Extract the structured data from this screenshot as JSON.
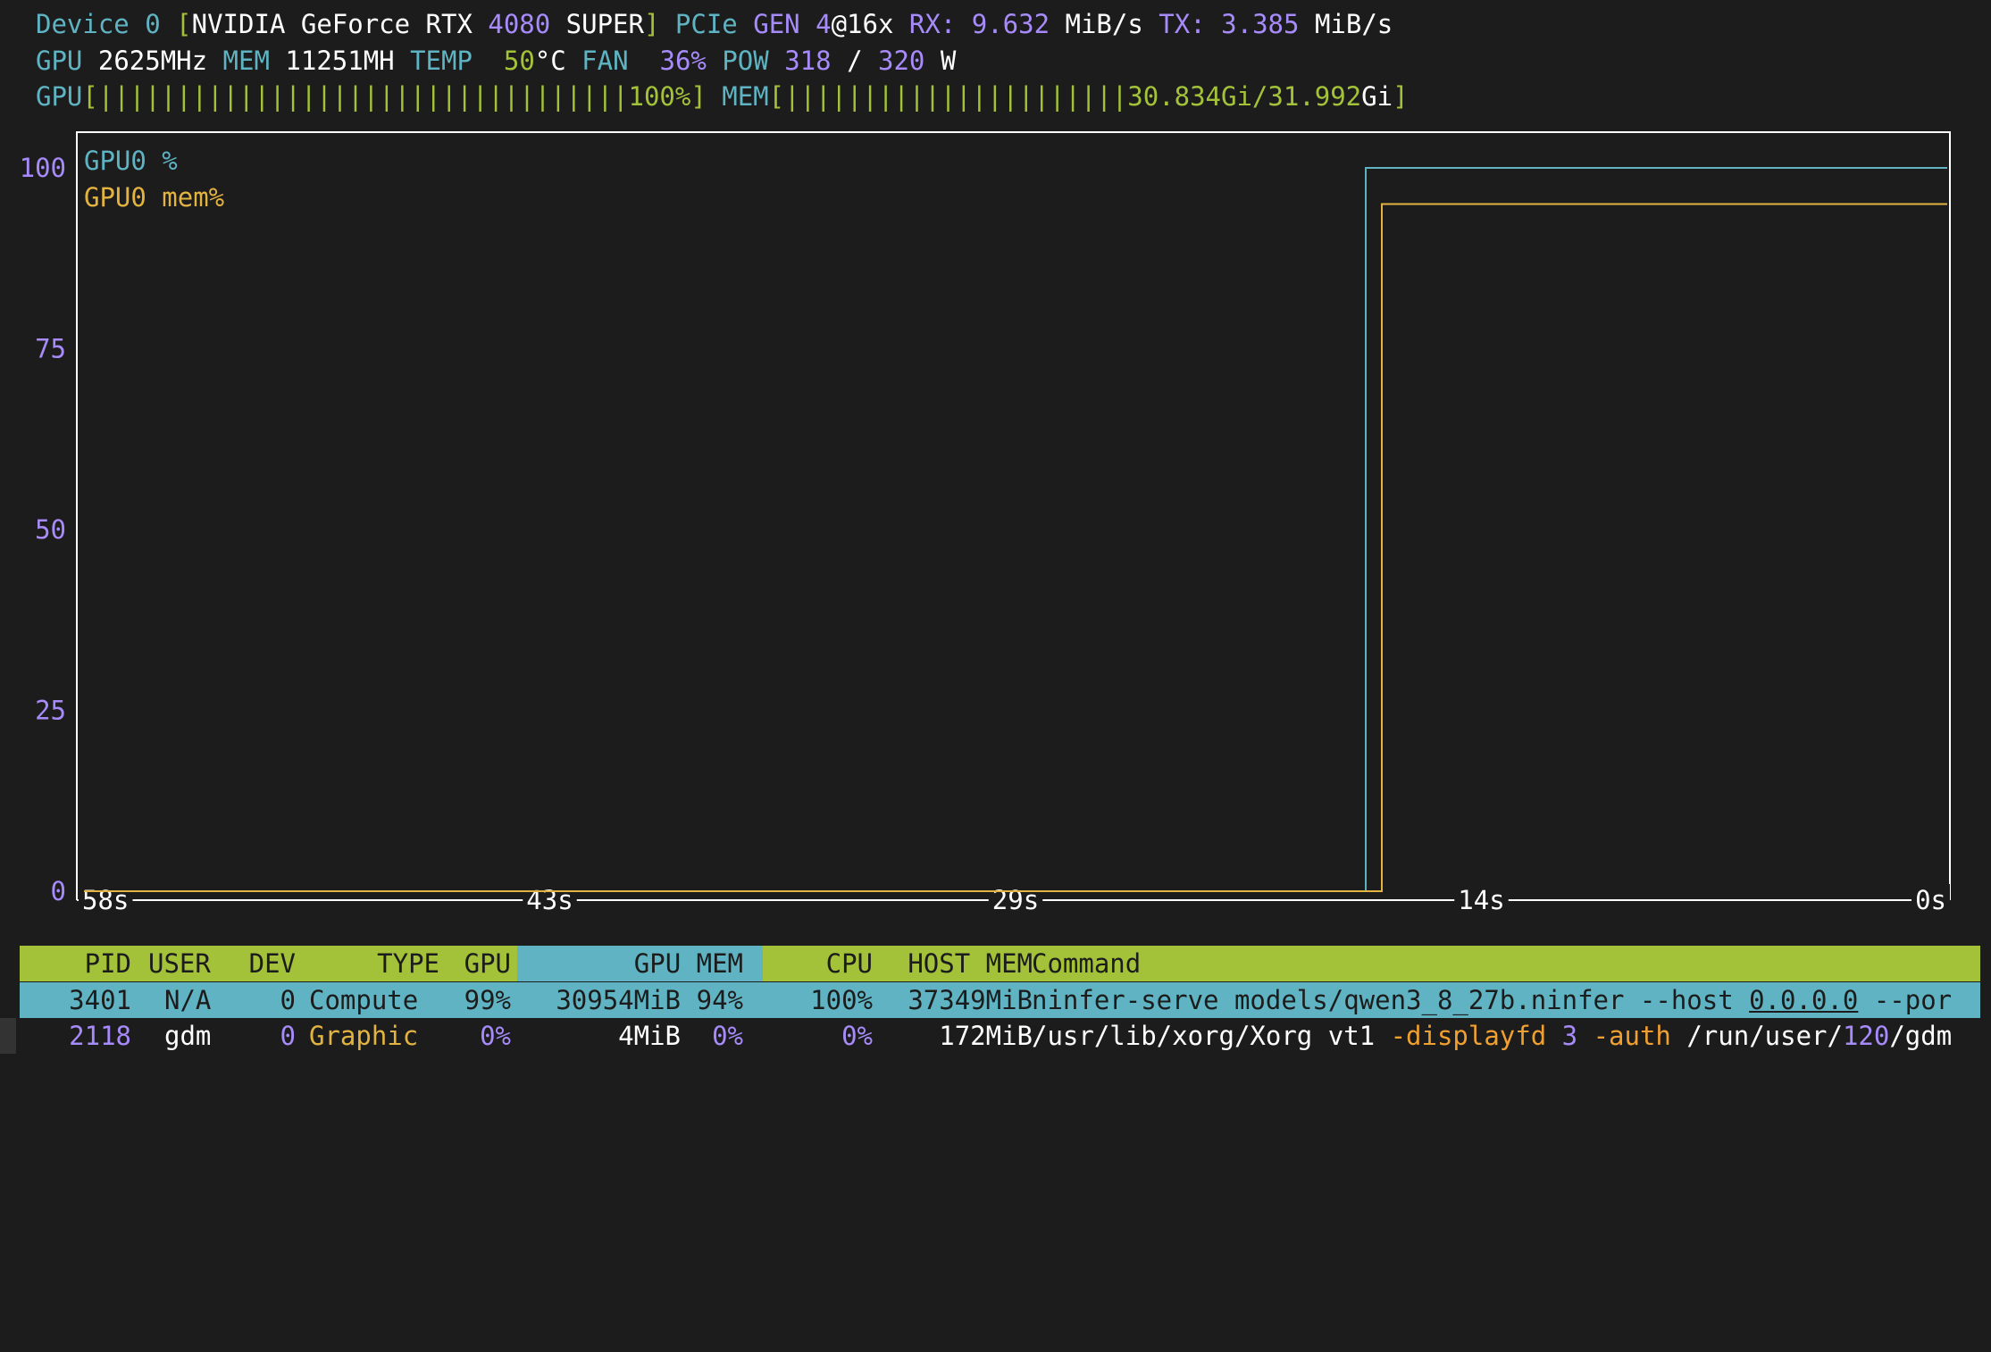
{
  "header": {
    "device_label": "Device",
    "device_index": "0",
    "gpu_name_a": "NVIDIA GeForce RTX ",
    "gpu_name_num": "4080",
    "gpu_name_b": " SUPER",
    "pcie_label": "PCIe",
    "gen_label": "GEN",
    "gen_value": "4",
    "lanes": "@16x",
    "rx_label": "RX:",
    "rx_value": "9.632",
    "rx_unit": "MiB/s",
    "tx_label": "TX:",
    "tx_value": "3.385",
    "tx_unit": "MiB/s"
  },
  "stats": {
    "gpu_label": "GPU",
    "gpu_clock": "2625MHz",
    "mem_label": "MEM",
    "mem_clock": "11251MH",
    "temp_label": "TEMP",
    "temp_value": "50",
    "temp_unit": "°C",
    "fan_label": "FAN",
    "fan_value": "36%",
    "pow_label": "POW",
    "pow_value": "318",
    "pow_sep": "/",
    "pow_max": "320",
    "pow_unit": "W"
  },
  "bars": {
    "gpu_label": "GPU",
    "gpu_bar": "||||||||||||||||||||||||||||||||||",
    "gpu_text": "100%",
    "gpu_fraction": 1.0,
    "mem_label": "MEM",
    "mem_bar": "||||||||||||||||||||||",
    "mem_used": "30.834Gi/31.992",
    "mem_unit": "Gi",
    "mem_fraction": 0.964
  },
  "chart_data": {
    "type": "line",
    "y_ticks": [
      "100",
      "75",
      "50",
      "25",
      "0"
    ],
    "ylim": [
      0,
      100
    ],
    "x_ticks": [
      "58s",
      "43s",
      "29s",
      "14s",
      "0s"
    ],
    "xlim": [
      -58,
      0
    ],
    "grid": false,
    "legend_position": "top-left",
    "series": [
      {
        "name": "GPU0 %",
        "color": "#5fb3c2",
        "x": [
          -58,
          -18.1,
          -18.1,
          0
        ],
        "y": [
          0,
          0,
          100,
          100
        ]
      },
      {
        "name": "GPU0 mem%",
        "color": "#e3b341",
        "x": [
          -58,
          -17.6,
          -17.6,
          0
        ],
        "y": [
          0,
          0,
          95,
          95
        ]
      }
    ]
  },
  "table": {
    "headers": {
      "pid": "PID",
      "user": "USER",
      "dev": "DEV",
      "type": "TYPE",
      "gpu": "GPU",
      "gpu_mem": "GPU MEM",
      "cpu": "CPU",
      "host_mem": "HOST MEM",
      "command": "Command"
    },
    "rows": [
      {
        "pid": "3401",
        "user": "N/A",
        "dev": "0",
        "type": "Compute",
        "gpu": "99%",
        "gpu_mem": "30954MiB",
        "gpu_mem_pct": "94%",
        "cpu": "100%",
        "host_mem": "37349MiB",
        "command_a": "ninfer-serve models/qwen3_8_27b.ninfer --host ",
        "command_host": "0.0.0.0",
        "command_b": " --por"
      },
      {
        "pid": "2118",
        "user": "gdm",
        "dev": "0",
        "type": "Graphic",
        "gpu": "0%",
        "gpu_mem": "4MiB",
        "gpu_mem_pct": "0%",
        "cpu": "0%",
        "host_mem": "172MiB",
        "cmd_path": "/usr/lib/xorg/Xorg vt1 ",
        "cmd_flag1": "-displayfd",
        "cmd_num1": " 3 ",
        "cmd_flag2": "-auth",
        "cmd_path2a": " /run/user/",
        "cmd_num2": "120",
        "cmd_path2b": "/gdm"
      }
    ]
  },
  "colors": {
    "background": "#1c1c1c",
    "cyan": "#5fb3c2",
    "purple": "#a78bfa",
    "green": "#a3c23a",
    "orange": "#f0a030",
    "yellow": "#e3b341"
  }
}
